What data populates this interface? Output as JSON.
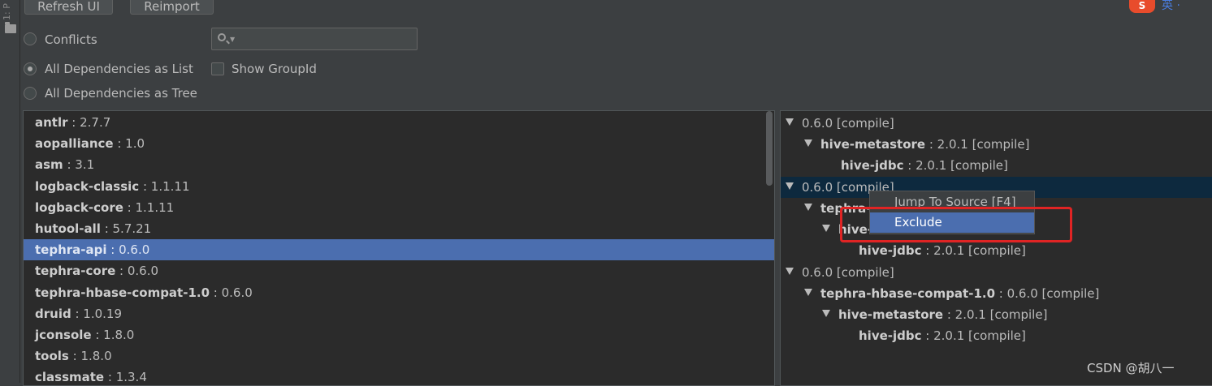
{
  "toolbar": {
    "refresh_label": "Refresh UI",
    "reimport_label": "Reimport"
  },
  "sidestrip": {
    "label": "1: P"
  },
  "options": {
    "conflicts": "Conflicts",
    "all_list": "All Dependencies as List",
    "all_tree": "All Dependencies as Tree",
    "show_group_id": "Show GroupId",
    "selected_view": "All Dependencies as List",
    "show_group_id_checked": false
  },
  "search": {
    "value": "",
    "placeholder": ""
  },
  "dependencies": [
    {
      "name": "antlr",
      "sep": " : ",
      "version": "2.7.7"
    },
    {
      "name": "aopalliance",
      "sep": " : ",
      "version": "1.0"
    },
    {
      "name": "asm",
      "sep": " : ",
      "version": "3.1"
    },
    {
      "name": "logback-classic",
      "sep": " : ",
      "version": "1.1.11"
    },
    {
      "name": "logback-core",
      "sep": " : ",
      "version": "1.1.11"
    },
    {
      "name": "hutool-all",
      "sep": " : ",
      "version": "5.7.21"
    },
    {
      "name": "tephra-api",
      "sep": " : ",
      "version": "0.6.0",
      "selected": true
    },
    {
      "name": "tephra-core",
      "sep": " : ",
      "version": "0.6.0"
    },
    {
      "name": "tephra-hbase-compat-1.0",
      "sep": " : ",
      "version": "0.6.0"
    },
    {
      "name": "druid",
      "sep": " : ",
      "version": "1.0.19"
    },
    {
      "name": "jconsole",
      "sep": " : ",
      "version": "1.8.0"
    },
    {
      "name": "tools",
      "sep": " : ",
      "version": "1.8.0"
    },
    {
      "name": "classmate",
      "sep": " : ",
      "version": "1.3.4"
    }
  ],
  "usages": {
    "r0": {
      "text": "0.6.0 [compile]"
    },
    "r1": {
      "name": "hive-metastore",
      "rest": " : 2.0.1 [compile]"
    },
    "r2": {
      "name": "hive-jdbc",
      "rest": " : 2.0.1 [compile]"
    },
    "r3": {
      "text": "0.6.0 [compile]"
    },
    "r4": {
      "name": "tephra-",
      "rest": ""
    },
    "r5": {
      "name": "hive-",
      "rest": ""
    },
    "r6": {
      "name": "hive-jdbc",
      "rest": " : 2.0.1 [compile]"
    },
    "r7": {
      "text": "0.6.0 [compile]"
    },
    "r8": {
      "name": "tephra-hbase-compat-1.0",
      "rest": " : 0.6.0 [compile]"
    },
    "r9": {
      "name": "hive-metastore",
      "rest": " : 2.0.1 [compile]"
    },
    "r10": {
      "name": "hive-jdbc",
      "rest": " : 2.0.1 [compile]"
    }
  },
  "context_menu": {
    "jump_to_source": "Jump To Source [F4]",
    "exclude": "Exclude"
  },
  "brand": {
    "logo_letter": "S",
    "logo_text": "英 ·"
  },
  "watermark": "CSDN @胡八一"
}
